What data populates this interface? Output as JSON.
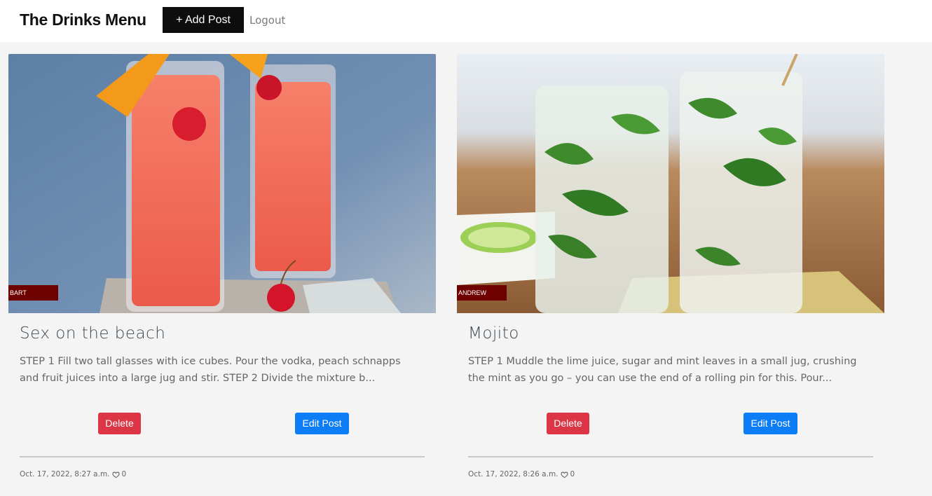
{
  "navbar": {
    "brand": "The Drinks Menu",
    "add_post_label": "+ Add Post",
    "logout_label": "Logout"
  },
  "posts": [
    {
      "author": "BART",
      "title": "Sex on the beach",
      "excerpt": "STEP 1 Fill two tall glasses with ice cubes. Pour the vodka, peach schnapps and fruit juices into a large jug and stir. STEP 2 Divide the mixture b...",
      "delete_label": "Delete",
      "edit_label": "Edit Post",
      "date": "Oct. 17, 2022, 8:27 a.m.",
      "likes": "0",
      "image_icon": "red-cocktail-photo"
    },
    {
      "author": "ANDREW",
      "title": "Mojito",
      "excerpt": "STEP 1 Muddle the lime juice, sugar and mint leaves in a small jug, crushing the mint as you go – you can use the end of a rolling pin for this. Pour...",
      "delete_label": "Delete",
      "edit_label": "Edit Post",
      "date": "Oct. 17, 2022, 8:26 a.m.",
      "likes": "0",
      "image_icon": "mojito-photo"
    }
  ],
  "colors": {
    "author_badge": "#6e0000",
    "delete": "#dc3545",
    "edit": "#0d7df6",
    "add_post": "#0d0d0d"
  }
}
